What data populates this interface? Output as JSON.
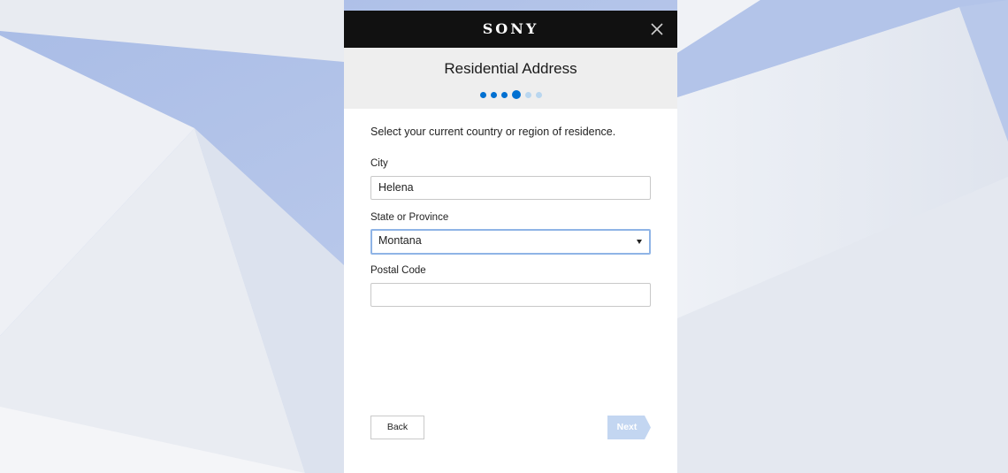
{
  "brand": {
    "logo_text": "SONY"
  },
  "dialog": {
    "title": "Residential Address",
    "steps": {
      "total": 6,
      "current": 4
    },
    "instruction": "Select your current country or region of residence."
  },
  "form": {
    "city": {
      "label": "City",
      "value": "Helena"
    },
    "state": {
      "label": "State or Province",
      "value": "Montana"
    },
    "postal": {
      "label": "Postal Code",
      "value": ""
    }
  },
  "buttons": {
    "back": "Back",
    "next": "Next"
  },
  "icons": {
    "close": "close-icon",
    "dropdown": "chevron-down-icon"
  },
  "colors": {
    "accent": "#0070d1",
    "header_bar": "#111111",
    "next_disabled": "#c3d6f1"
  }
}
